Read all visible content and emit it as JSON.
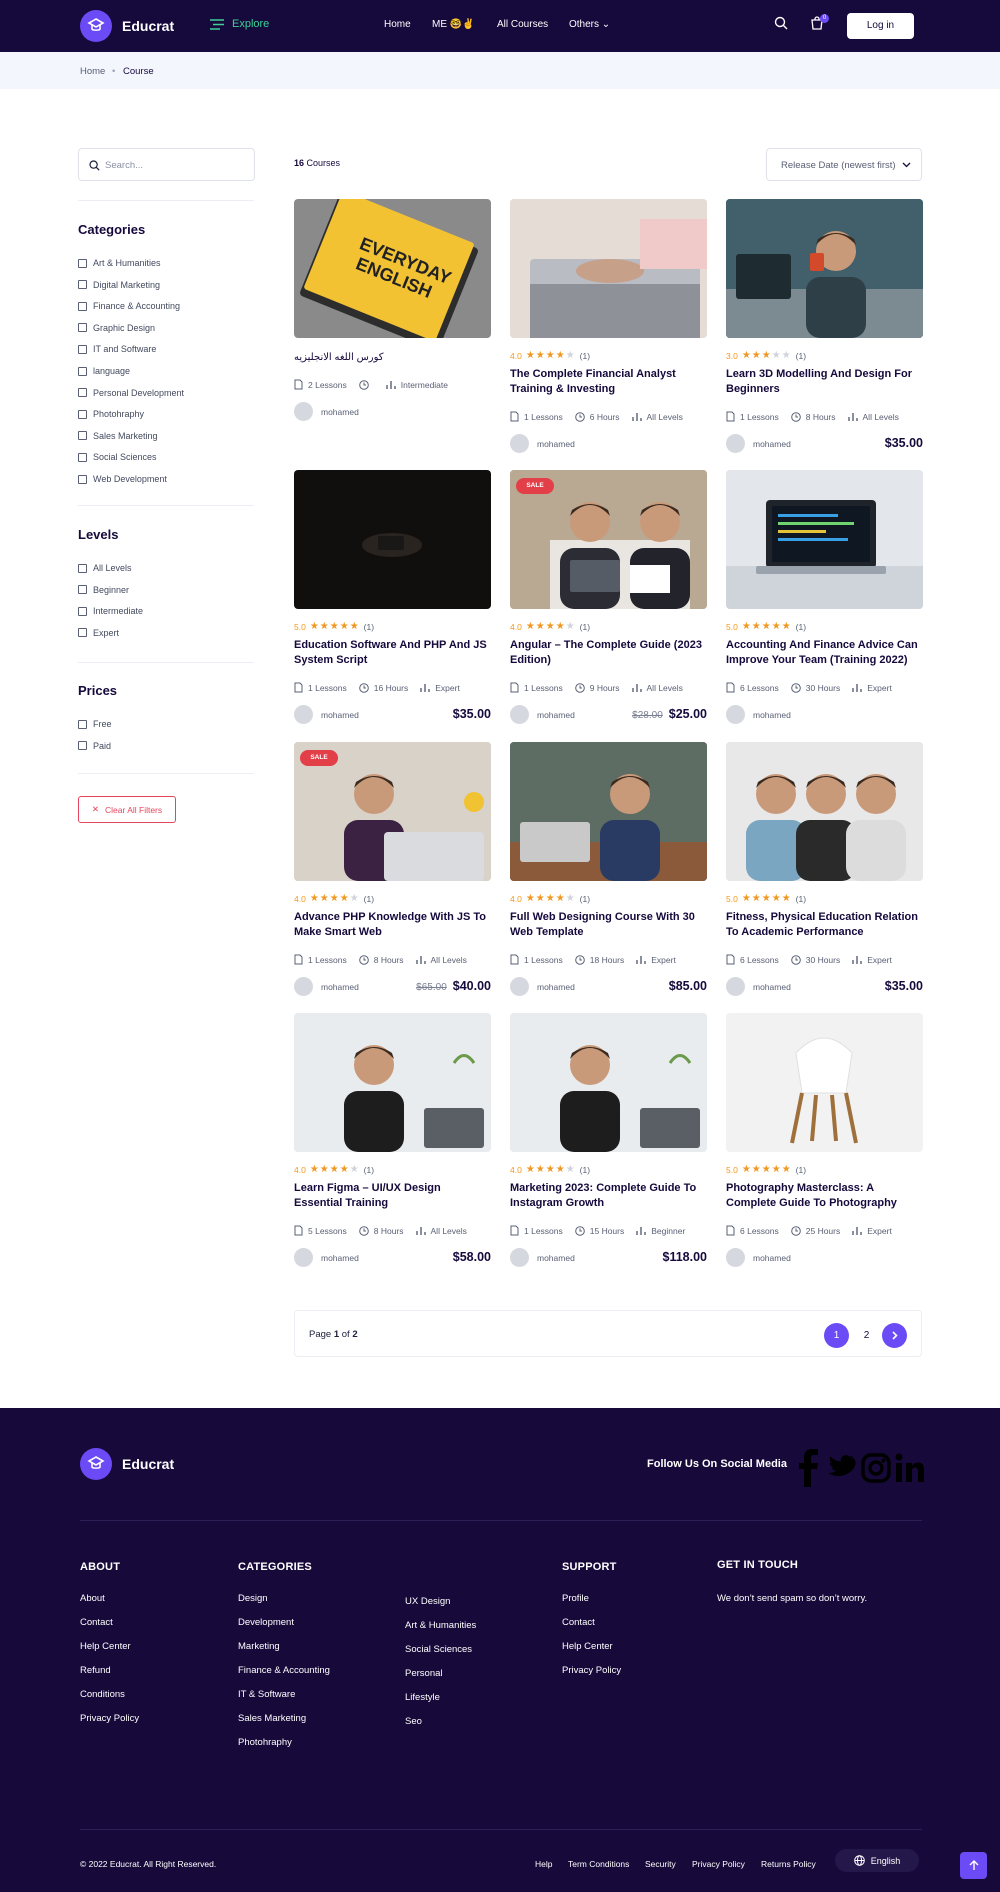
{
  "header": {
    "brand": "Educrat",
    "explore": "Explore",
    "nav": [
      "Home",
      "ME 🤓✌",
      "All Courses",
      "Others"
    ],
    "cart_count": "0",
    "login": "Log in"
  },
  "breadcrumb": {
    "home": "Home",
    "current": "Course"
  },
  "sidebar": {
    "search_placeholder": "Search...",
    "categories_title": "Categories",
    "categories": [
      "Art & Humanities",
      "Digital Marketing",
      "Finance & Accounting",
      "Graphic Design",
      "IT and Software",
      "language",
      "Personal Development",
      "Photohraphy",
      "Sales Marketing",
      "Social Sciences",
      "Web Development"
    ],
    "levels_title": "Levels",
    "levels": [
      "All Levels",
      "Beginner",
      "Intermediate",
      "Expert"
    ],
    "prices_title": "Prices",
    "prices": [
      "Free",
      "Paid"
    ],
    "clear_label": "Clear All Filters"
  },
  "toolbar": {
    "count_num": "16",
    "count_label": "Courses",
    "sort_label": "Release Date (newest first)"
  },
  "courses": [
    {
      "title": "كورس اللغه الانجليزيه",
      "rating": "",
      "stars": 0,
      "reviews": "",
      "lessons": "2 Lessons",
      "hours": "",
      "level": "Intermediate",
      "author": "mohamed",
      "old_price": "",
      "price": "",
      "sale": "",
      "image": "everyday-english-book"
    },
    {
      "title": "The Complete Financial Analyst Training & Investing",
      "rating": "4.0",
      "stars": 4,
      "reviews": "(1)",
      "lessons": "1 Lessons",
      "hours": "6 Hours",
      "level": "All Levels",
      "author": "mohamed",
      "old_price": "",
      "price": "",
      "sale": "",
      "image": "laptop-typing"
    },
    {
      "title": "Learn 3D Modelling And Design For Beginners",
      "rating": "3.0",
      "stars": 3,
      "reviews": "(1)",
      "lessons": "1 Lessons",
      "hours": "8 Hours",
      "level": "All Levels",
      "author": "mohamed",
      "old_price": "",
      "price": "$35.00",
      "sale": "",
      "image": "man-drinking-coffee"
    },
    {
      "title": "Education Software And PHP And JS System Script",
      "rating": "5.0",
      "stars": 5,
      "reviews": "(1)",
      "lessons": "1 Lessons",
      "hours": "16 Hours",
      "level": "Expert",
      "author": "mohamed",
      "old_price": "",
      "price": "$35.00",
      "sale": "",
      "image": "dark-phone"
    },
    {
      "title": "Angular – The Complete Guide (2023 Edition)",
      "rating": "4.0",
      "stars": 4,
      "reviews": "(1)",
      "lessons": "1 Lessons",
      "hours": "9 Hours",
      "level": "All Levels",
      "author": "mohamed",
      "old_price": "$28.00",
      "price": "$25.00",
      "sale": "SALE",
      "image": "team-meeting"
    },
    {
      "title": "Accounting And Finance Advice Can Improve Your Team (Training 2022)",
      "rating": "5.0",
      "stars": 5,
      "reviews": "(1)",
      "lessons": "6 Lessons",
      "hours": "30 Hours",
      "level": "Expert",
      "author": "mohamed",
      "old_price": "",
      "price": "",
      "sale": "",
      "image": "laptop-code"
    },
    {
      "title": "Advance PHP Knowledge With JS To Make Smart Web",
      "rating": "4.0",
      "stars": 4,
      "reviews": "(1)",
      "lessons": "1 Lessons",
      "hours": "8 Hours",
      "level": "All Levels",
      "author": "mohamed",
      "old_price": "$65.00",
      "price": "$40.00",
      "sale": "SALE",
      "image": "man-laptop-smiling"
    },
    {
      "title": "Full Web Designing Course With 30 Web Template",
      "rating": "4.0",
      "stars": 4,
      "reviews": "(1)",
      "lessons": "1 Lessons",
      "hours": "18 Hours",
      "level": "Expert",
      "author": "mohamed",
      "old_price": "",
      "price": "$85.00",
      "sale": "",
      "image": "man-suit-laptop"
    },
    {
      "title": "Fitness, Physical Education Relation To Academic Performance",
      "rating": "5.0",
      "stars": 5,
      "reviews": "(1)",
      "lessons": "6 Lessons",
      "hours": "30 Hours",
      "level": "Expert",
      "author": "mohamed",
      "old_price": "",
      "price": "$35.00",
      "sale": "",
      "image": "three-men"
    },
    {
      "title": "Learn Figma – UI/UX Design Essential Training",
      "rating": "4.0",
      "stars": 4,
      "reviews": "(1)",
      "lessons": "5 Lessons",
      "hours": "8 Hours",
      "level": "All Levels",
      "author": "mohamed",
      "old_price": "",
      "price": "$58.00",
      "sale": "",
      "image": "man-black-shirt"
    },
    {
      "title": "Marketing 2023: Complete Guide To Instagram Growth",
      "rating": "4.0",
      "stars": 4,
      "reviews": "(1)",
      "lessons": "1 Lessons",
      "hours": "15 Hours",
      "level": "Beginner",
      "author": "mohamed",
      "old_price": "",
      "price": "$118.00",
      "sale": "",
      "image": "man-black-shirt"
    },
    {
      "title": "Photography Masterclass: A Complete Guide To Photography",
      "rating": "5.0",
      "stars": 5,
      "reviews": "(1)",
      "lessons": "6 Lessons",
      "hours": "25 Hours",
      "level": "Expert",
      "author": "mohamed",
      "old_price": "",
      "price": "",
      "sale": "",
      "image": "white-chair"
    }
  ],
  "pagination": {
    "pre": "Page",
    "current": "1",
    "of": "of",
    "total": "2",
    "pages": [
      "1",
      "2"
    ]
  },
  "footer": {
    "brand": "Educrat",
    "follow": "Follow Us On Social Media",
    "about_title": "ABOUT",
    "about_links": [
      "About",
      "Contact",
      "Help Center",
      "Refund",
      "Conditions",
      "Privacy Policy"
    ],
    "categories_title": "CATEGORIES",
    "categories_col1": [
      "Design",
      "Development",
      "Marketing",
      "Finance & Accounting",
      "IT & Software",
      "Sales Marketing",
      "Photohraphy"
    ],
    "categories_col2": [
      "UX Design",
      "Art & Humanities",
      "Social Sciences",
      "Personal",
      "Lifestyle",
      "Seo"
    ],
    "support_title": "SUPPORT",
    "support_links": [
      "Profile",
      "Contact",
      "Help Center",
      "Privacy Policy"
    ],
    "touch_title": "GET IN TOUCH",
    "touch_text": "We don’t send spam so don’t worry.",
    "copyright": "© 2022 Educrat. All Right Reserved.",
    "bottom_links": [
      "Help",
      "Term Conditions",
      "Security",
      "Privacy Policy",
      "Returns Policy"
    ],
    "language": "English"
  },
  "colors": {
    "primary": "#6a4bf5",
    "header_bg": "#16093c",
    "accent_green": "#3ed096",
    "star": "#f29821",
    "sale": "#e23f49",
    "clear": "#e6455d"
  }
}
